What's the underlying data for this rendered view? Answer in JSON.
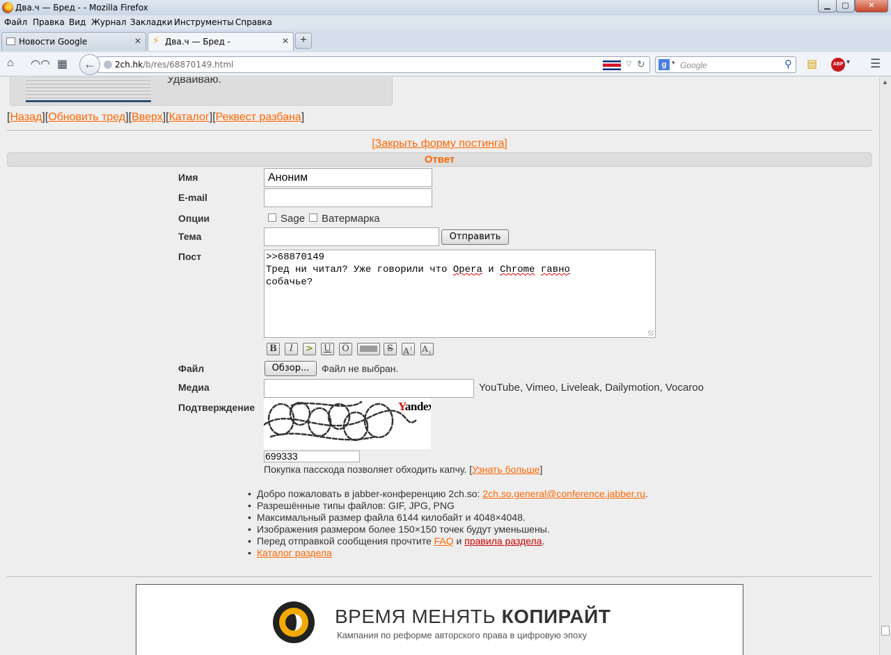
{
  "window": {
    "title": "Два.ч — Бред - - Mozilla Firefox"
  },
  "menu": [
    "Файл",
    "Правка",
    "Вид",
    "Журнал",
    "Закладки",
    "Инструменты",
    "Справка"
  ],
  "tabs": [
    {
      "title": "Новости Google",
      "active": false
    },
    {
      "title": "Два.ч — Бред -",
      "active": true
    }
  ],
  "urlbar": {
    "host": "2ch.hk",
    "path": "/b/res/68870149.html"
  },
  "search": {
    "placeholder": "Google"
  },
  "post": {
    "text": "Удваиваю."
  },
  "navlinks": [
    "Назад",
    "Обновить тред",
    "Вверх",
    "Каталог",
    "Реквест разбана"
  ],
  "form": {
    "close_link": "[Закрыть форму постинга]",
    "header": "Ответ",
    "name_label": "Имя",
    "name_value": "Аноним",
    "email_label": "E-mail",
    "options_label": "Опции",
    "sage_label": "Sage",
    "watermark_label": "Ватермарка",
    "subject_label": "Тема",
    "submit_label": "Отправить",
    "post_label": "Пост",
    "post_line1": ">>68870149",
    "post_line2_a": "Тред ни читал? Уже говорили что ",
    "post_line2_opera": "Opera",
    "post_line2_b": " и ",
    "post_line2_chrome": "Chrome",
    "post_line2_c": " ",
    "post_line2_gavno": "гавно",
    "post_line3": "собачье?",
    "format_buttons": [
      "B",
      "I",
      ">",
      "U",
      "O",
      "",
      "S",
      "A",
      "A"
    ],
    "file_label": "Файл",
    "browse_label": "Обзор...",
    "file_status": "Файл не выбран.",
    "media_label": "Медиа",
    "media_hint": "YouTube, Vimeo, Liveleak, Dailymotion, Vocaroo",
    "captcha_label": "Подтверждение",
    "captcha_brand_y": "Y",
    "captcha_brand_rest": "andex",
    "captcha_value": "699333",
    "passcode_text": "Покупка пасскода позволяет обходить капчу. [",
    "passcode_link": "Узнать больше",
    "passcode_end": "]"
  },
  "info": {
    "jabber_text": "Добро пожаловать в jabber-конференцию 2ch.so: ",
    "jabber_link": "2ch.so.general@conference.jabber.ru",
    "jabber_end": ".",
    "types": "Разрешённые типы файлов: GIF, JPG, PNG",
    "maxsize": "Максимальный размер файла 6144 килобайт и 4048×4048.",
    "resize": "Изображения размером более 150×150 точек будут уменьшены.",
    "rules_text": "Перед отправкой сообщения прочтите ",
    "faq_link": "FAQ",
    "rules_and": " и ",
    "rules_link": "правила раздела",
    "rules_end": ".",
    "catalog_link": "Каталог раздела"
  },
  "banner": {
    "headline_light": "ВРЕМЯ МЕНЯТЬ ",
    "headline_bold": "КОПИРАЙТ",
    "subline": "Кампания по реформе авторского права в цифровую эпоху"
  },
  "colors": {
    "link": "#ff6600",
    "rules_link": "#cc0000",
    "reply_header": "#ff6600",
    "banner_accent": "#f2a900"
  }
}
